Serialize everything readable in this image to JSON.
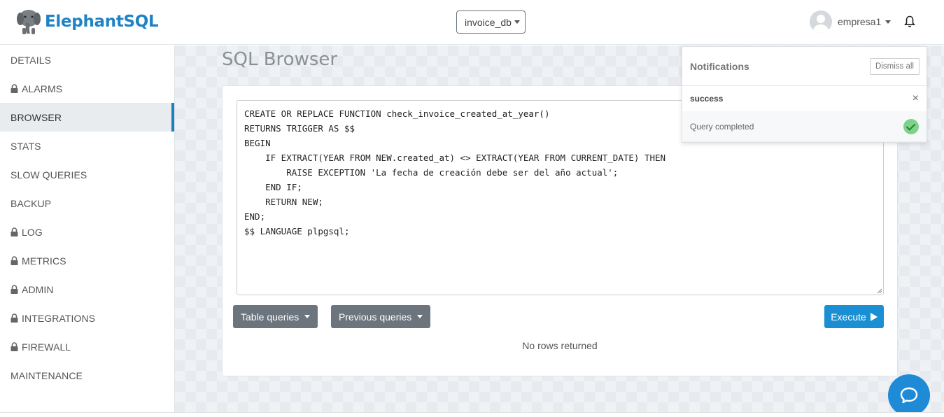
{
  "header": {
    "brand": "ElephantSQL",
    "database_selector": "invoice_db",
    "username": "empresa1"
  },
  "sidebar": {
    "items": [
      {
        "label": "DETAILS",
        "locked": false,
        "active": false
      },
      {
        "label": "ALARMS",
        "locked": true,
        "active": false
      },
      {
        "label": "BROWSER",
        "locked": false,
        "active": true
      },
      {
        "label": "STATS",
        "locked": false,
        "active": false
      },
      {
        "label": "SLOW QUERIES",
        "locked": false,
        "active": false
      },
      {
        "label": "BACKUP",
        "locked": false,
        "active": false
      },
      {
        "label": "LOG",
        "locked": true,
        "active": false
      },
      {
        "label": "METRICS",
        "locked": true,
        "active": false
      },
      {
        "label": "ADMIN",
        "locked": true,
        "active": false
      },
      {
        "label": "INTEGRATIONS",
        "locked": true,
        "active": false
      },
      {
        "label": "FIREWALL",
        "locked": true,
        "active": false
      },
      {
        "label": "MAINTENANCE",
        "locked": false,
        "active": false
      }
    ]
  },
  "main": {
    "title": "SQL Browser",
    "query": "CREATE OR REPLACE FUNCTION check_invoice_created_at_year()\nRETURNS TRIGGER AS $$\nBEGIN\n    IF EXTRACT(YEAR FROM NEW.created_at) <> EXTRACT(YEAR FROM CURRENT_DATE) THEN\n        RAISE EXCEPTION 'La fecha de creación debe ser del año actual';\n    END IF;\n    RETURN NEW;\nEND;\n$$ LANGUAGE plpgsql;",
    "table_queries_label": "Table queries",
    "previous_queries_label": "Previous queries",
    "execute_label": "Execute",
    "result_text": "No rows returned"
  },
  "notifications": {
    "title": "Notifications",
    "dismiss_all_label": "Dismiss all",
    "items": [
      {
        "type": "success",
        "message": "Query completed",
        "close": "×"
      }
    ]
  },
  "colors": {
    "brand": "#1f82c4",
    "active_indicator": "#1b7fc2",
    "execute_button": "#1a8fd3",
    "secondary_button": "#6c757d",
    "success": "#7dd389"
  },
  "icons": {
    "logo": "elephant-logo-icon",
    "bell": "bell-icon",
    "lock": "lock-icon",
    "play": "play-icon",
    "check": "check-circle-icon",
    "chat": "chat-bubble-icon"
  }
}
